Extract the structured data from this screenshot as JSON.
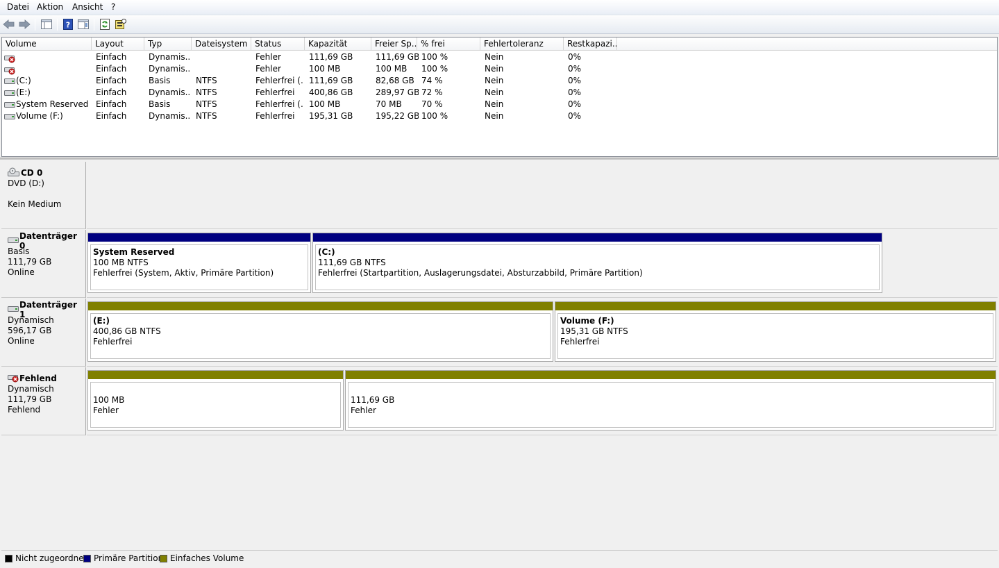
{
  "menu": [
    "Datei",
    "Aktion",
    "Ansicht",
    "?"
  ],
  "toolbar": [
    "back-icon",
    "forward-icon",
    "console-tree-icon",
    "help-icon",
    "properties-pane-icon",
    "refresh-icon",
    "rescan-disks-icon"
  ],
  "columns": [
    "Volume",
    "Layout",
    "Typ",
    "Dateisystem",
    "Status",
    "Kapazität",
    "Freier Sp...",
    "% frei",
    "Fehlertoleranz",
    "Restkapazi..."
  ],
  "volumes": [
    {
      "name": "",
      "icon": "error",
      "layout": "Einfach",
      "typ": "Dynamis...",
      "fs": "",
      "status": "Fehler",
      "kap": "111,69 GB",
      "frei": "111,69 GB",
      "pfrei": "100 %",
      "ft": "Nein",
      "rest": "0%"
    },
    {
      "name": "",
      "icon": "error",
      "layout": "Einfach",
      "typ": "Dynamis...",
      "fs": "",
      "status": "Fehler",
      "kap": "100 MB",
      "frei": "100 MB",
      "pfrei": "100 %",
      "ft": "Nein",
      "rest": "0%"
    },
    {
      "name": "(C:)",
      "icon": "ok",
      "layout": "Einfach",
      "typ": "Basis",
      "fs": "NTFS",
      "status": "Fehlerfrei (...",
      "kap": "111,69 GB",
      "frei": "82,68 GB",
      "pfrei": "74 %",
      "ft": "Nein",
      "rest": "0%"
    },
    {
      "name": "(E:)",
      "icon": "ok",
      "layout": "Einfach",
      "typ": "Dynamis...",
      "fs": "NTFS",
      "status": "Fehlerfrei",
      "kap": "400,86 GB",
      "frei": "289,97 GB",
      "pfrei": "72 %",
      "ft": "Nein",
      "rest": "0%"
    },
    {
      "name": "System Reserved",
      "icon": "ok",
      "layout": "Einfach",
      "typ": "Basis",
      "fs": "NTFS",
      "status": "Fehlerfrei (...",
      "kap": "100 MB",
      "frei": "70 MB",
      "pfrei": "70 %",
      "ft": "Nein",
      "rest": "0%"
    },
    {
      "name": "Volume (F:)",
      "icon": "ok",
      "layout": "Einfach",
      "typ": "Dynamis...",
      "fs": "NTFS",
      "status": "Fehlerfrei",
      "kap": "195,31 GB",
      "frei": "195,22 GB",
      "pfrei": "100 %",
      "ft": "Nein",
      "rest": "0%"
    }
  ],
  "disks": [
    {
      "title": "CD 0",
      "icon": "cd",
      "lines": [
        "DVD (D:)",
        "",
        "Kein Medium"
      ],
      "parts": []
    },
    {
      "title": "Datenträger 0",
      "icon": "disk",
      "lines": [
        "Basis",
        "111,79 GB",
        "Online"
      ],
      "parts": [
        {
          "kind": "primary",
          "name": "System Reserved",
          "size": "100 MB NTFS",
          "status": "Fehlerfrei (System, Aktiv, Primäre Partition)"
        },
        {
          "kind": "primary",
          "name": "(C:)",
          "size": "111,69 GB NTFS",
          "status": "Fehlerfrei (Startpartition, Auslagerungsdatei, Absturzabbild, Primäre Partition)"
        }
      ]
    },
    {
      "title": "Datenträger 1",
      "icon": "disk",
      "lines": [
        "Dynamisch",
        "596,17 GB",
        "Online"
      ],
      "parts": [
        {
          "kind": "simple",
          "name": "(E:)",
          "size": "400,86 GB NTFS",
          "status": "Fehlerfrei"
        },
        {
          "kind": "simple",
          "name": "Volume  (F:)",
          "size": "195,31 GB NTFS",
          "status": "Fehlerfrei"
        }
      ]
    },
    {
      "title": "Fehlend",
      "icon": "disk-error",
      "lines": [
        "Dynamisch",
        "111,79 GB",
        "Fehlend"
      ],
      "parts": [
        {
          "kind": "simple",
          "name": "",
          "size": "100 MB",
          "status": "Fehler"
        },
        {
          "kind": "simple",
          "name": "",
          "size": "111,69 GB",
          "status": "Fehler"
        }
      ]
    }
  ],
  "legend": [
    {
      "label": "Nicht zugeordnet",
      "color": "#000000"
    },
    {
      "label": "Primäre Partition",
      "color": "#000080"
    },
    {
      "label": "Einfaches Volume",
      "color": "#808000"
    }
  ],
  "colors": {
    "primary": "#000080",
    "simple": "#808000",
    "unallocated": "#000000"
  }
}
